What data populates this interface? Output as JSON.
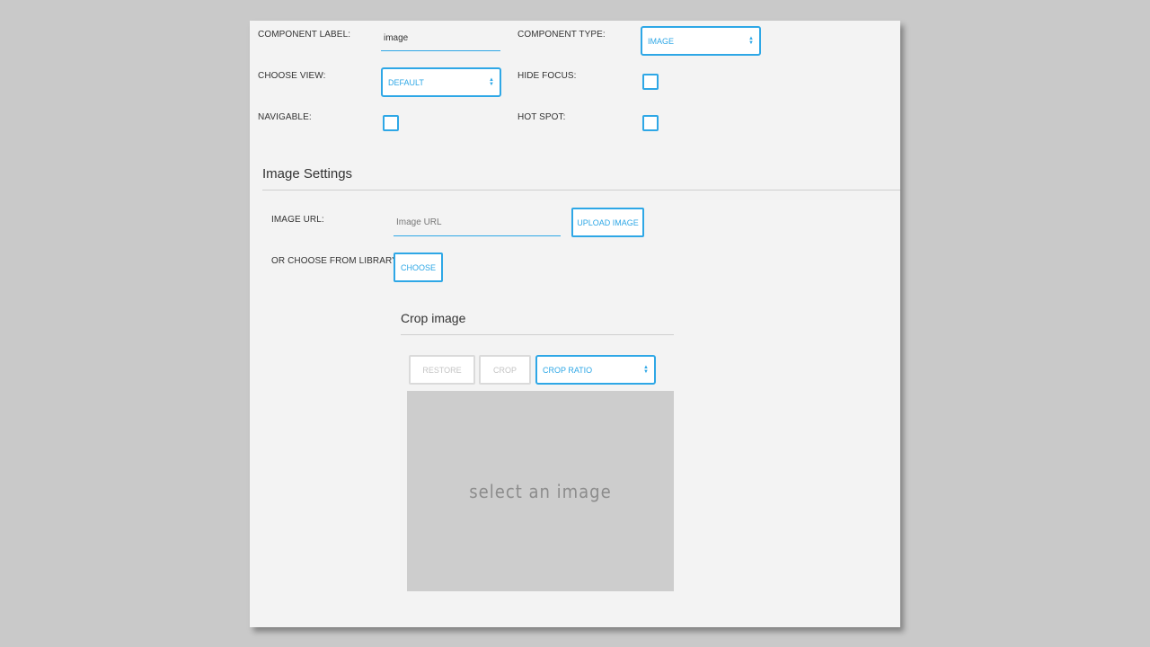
{
  "component": {
    "label_title": "COMPONENT LABEL:",
    "label_value": "image",
    "type_title": "COMPONENT TYPE:",
    "type_value": "IMAGE",
    "view_title": "CHOOSE VIEW:",
    "view_value": "DEFAULT",
    "hide_focus_title": "HIDE FOCUS:",
    "navigable_title": "NAVIGABLE:",
    "hot_spot_title": "HOT SPOT:"
  },
  "image_settings": {
    "title": "Image Settings",
    "url_title": "IMAGE URL:",
    "url_placeholder": "Image URL",
    "upload_label": "UPLOAD IMAGE",
    "library_title": "OR CHOOSE FROM LIBRARY",
    "choose_label": "CHOOSE"
  },
  "crop": {
    "title": "Crop image",
    "restore_label": "RESTORE",
    "crop_label": "CROP",
    "ratio_value": "CROP RATIO",
    "placeholder": "select an image"
  },
  "colors": {
    "accent": "#2ea7e6",
    "background": "#c9c9c9",
    "panel": "#f3f3f3"
  },
  "icons": [
    "select-arrows-icon"
  ]
}
